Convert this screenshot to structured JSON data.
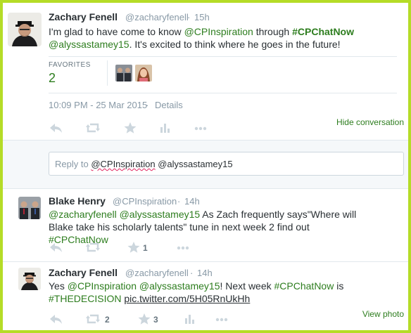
{
  "main_tweet": {
    "author_name": "Zachary Fenell",
    "author_handle": "@zacharyfenell",
    "time_ago": "15h",
    "text_part1": "I'm glad to have come to know ",
    "mention_1": "@CPInspiration",
    "text_part2": " through ",
    "hashtag": "#CPChatNow",
    "mention_2": "@alyssastamey15",
    "text_part3": ". It's excited to think where he goes in the future!",
    "favorites_label": "FAVORITES",
    "favorites_count": "2",
    "timestamp": "10:09 PM - 25 Mar 2015",
    "details_sep": " · ",
    "details_label": "Details",
    "hide_conversation": "Hide conversation"
  },
  "reply_box": {
    "prefix": "Reply to ",
    "mention_1": "@CPInspiration",
    "mention_2": "@alyssastamey15"
  },
  "reply_1": {
    "author_name": "Blake Henry",
    "author_handle": "@CPInspiration",
    "time_ago": "14h",
    "mention_1": "@zacharyfenell",
    "mention_2": "@alyssastamey15",
    "text_part1": " As Zach frequently says\"Where will Blake take his scholarly talents\" tune in next week 2 find out ",
    "hashtag": "#CPChatNow",
    "favorite_count": "1"
  },
  "reply_2": {
    "author_name": "Zachary Fenell",
    "author_handle": "@zacharyfenell",
    "time_ago": "14h",
    "prefix": "Yes ",
    "mention_1": "@CPInspiration",
    "mention_2": "@alyssastamey15",
    "text_part1": "! Next week ",
    "hashtag_1": "#CPChatNow",
    "text_part2": " is ",
    "hashtag_2": "#THEDECISION",
    "pic_link": "pic.twitter.com/5H05RnUkHh",
    "retweet_count": "2",
    "favorite_count": "3",
    "view_photo": "View photo"
  },
  "icons": [
    "reply-icon",
    "retweet-icon",
    "favorite-icon",
    "analytics-icon",
    "more-icon"
  ],
  "colors": {
    "page_border": "#b5dc27",
    "link": "#2d7d1e",
    "muted": "#8899a6",
    "action_icon": "#ccd6dd",
    "reply_band": "#f5f8fa"
  }
}
